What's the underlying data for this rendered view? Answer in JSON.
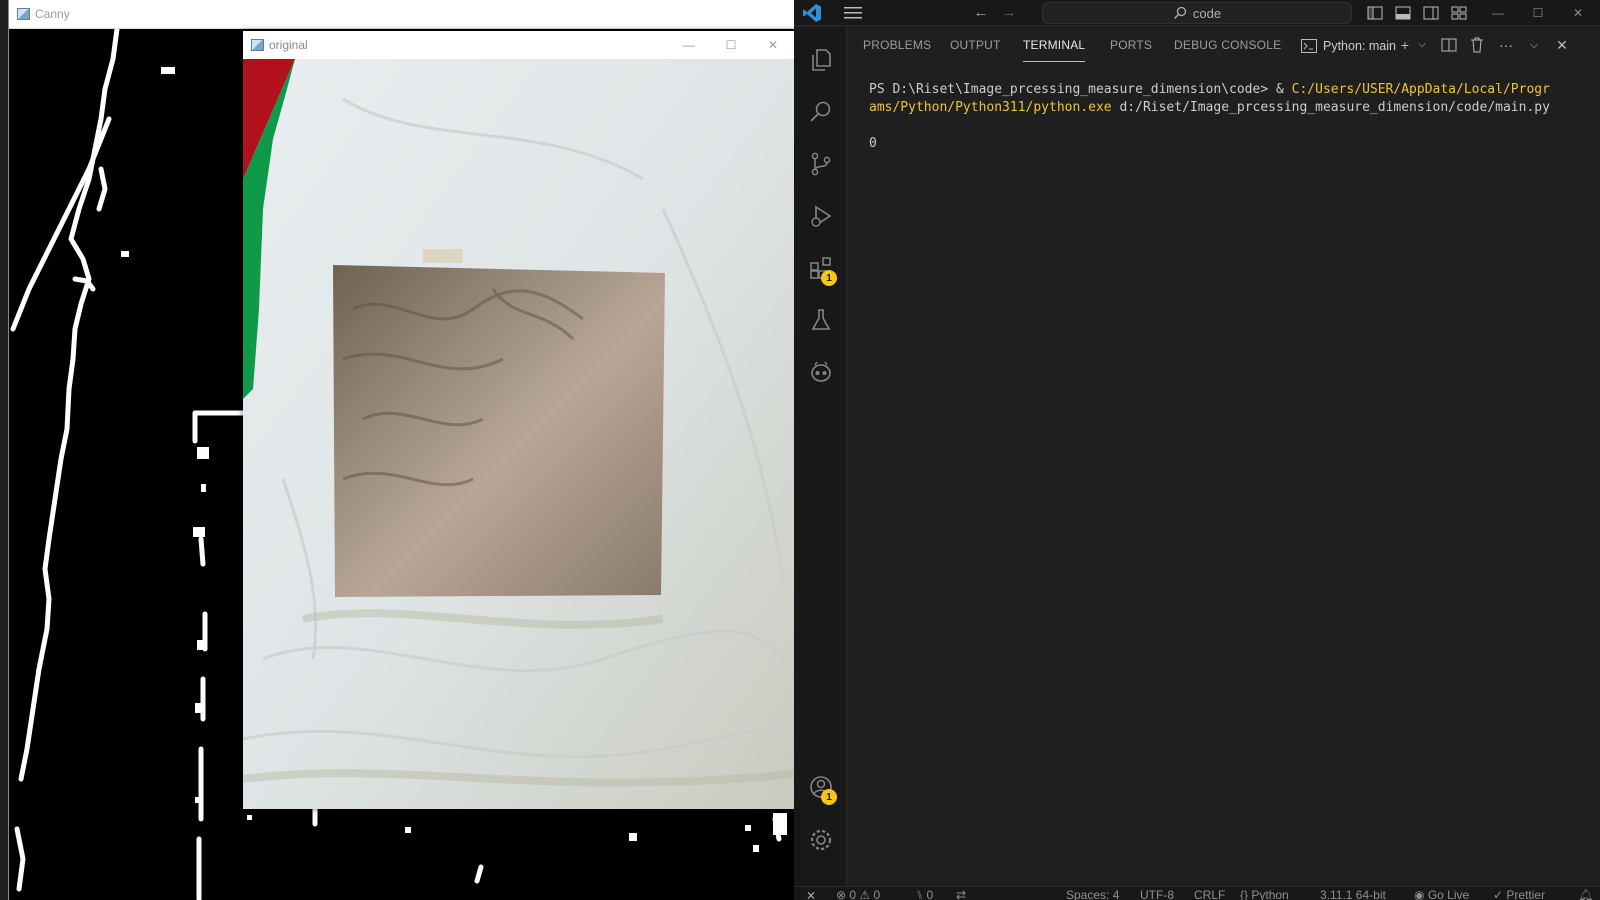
{
  "canny_window": {
    "title": "Canny"
  },
  "original_window": {
    "title": "original",
    "controls": {
      "minimize": "—",
      "maximize": "☐",
      "close": "✕"
    }
  },
  "vscode": {
    "search_text": "code",
    "activity_bar": {
      "items": [
        "explorer-icon",
        "search-icon",
        "source-control-icon",
        "run-debug-icon",
        "extensions-icon",
        "testing-icon",
        "copilot-icon"
      ],
      "extensions_badge": "1",
      "accounts_badge": "1"
    },
    "panel": {
      "tabs": [
        "PROBLEMS",
        "OUTPUT",
        "TERMINAL",
        "PORTS",
        "DEBUG CONSOLE"
      ],
      "active_tab": "TERMINAL",
      "terminal_name": "Python: main"
    },
    "terminal": {
      "prompt": "PS D:\\Riset\\Image_prcessing_measure_dimension\\code> & ",
      "exe_line1": "C:/Users/USER/AppData/Local/Progr",
      "exe_line2": "ams/Python/Python311/python.exe",
      "script_arg": " d:/Riset/Image_prcessing_measure_dimension/code/main.py",
      "output": "0"
    },
    "status_bar": {
      "errors": "0",
      "warnings": "0",
      "ports": "0",
      "spaces": "Spaces: 4",
      "encoding": "UTF-8",
      "eol": "CRLF",
      "language": "Python",
      "interpreter": "3.11.1 64-bit",
      "go_live": "Go Live",
      "prettier": "Prettier"
    },
    "colors": {
      "accent": "#f5c518",
      "path_highlight": "#f0c23b",
      "logo": "#2f8fd8"
    }
  }
}
